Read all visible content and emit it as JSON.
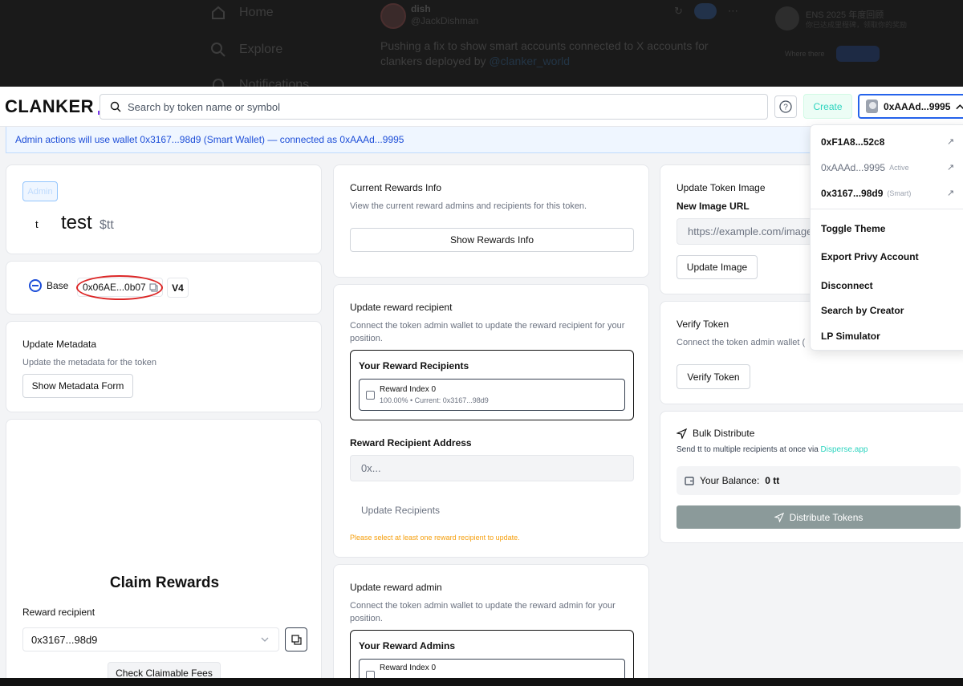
{
  "backdrop": {
    "nav": [
      "Home",
      "Explore",
      "Notifications"
    ],
    "author_name": "dish",
    "author_handle": "@JackDishman",
    "tweet_text": "Pushing a fix to show smart accounts connected to X accounts for clankers deployed by",
    "tweet_link": "@clanker_world",
    "right_title": "ENS 2025 年度回顾",
    "right_sub": "你已达成里程碑，领取你的奖励",
    "right_small": "Where there",
    "right_btn": "Follow"
  },
  "topbar": {
    "logo": "CLANKER",
    "search_placeholder": "Search by token name or symbol",
    "help_icon": "question-circle-icon",
    "create_label": "Create",
    "wallet_label": "0xAAAd...9995"
  },
  "banner": {
    "text": "Admin actions will use wallet 0x3167...98d9 (Smart Wallet) — connected as 0xAAAd...9995"
  },
  "token": {
    "admin_badge": "Admin",
    "letter": "t",
    "name": "test",
    "symbol": "$tt",
    "chain": "Base",
    "address": "0x06AE...0b07",
    "version": "V4"
  },
  "metadata": {
    "title": "Update Metadata",
    "subtitle": "Update the metadata for the token",
    "button": "Show Metadata Form"
  },
  "claim": {
    "title": "Claim Rewards",
    "recipient_label": "Reward recipient",
    "recipient_value": "0x3167...98d9",
    "check_button": "Check Claimable Fees"
  },
  "rewards_info": {
    "title": "Current Rewards Info",
    "subtitle": "View the current reward admins and recipients for this token.",
    "button": "Show Rewards Info"
  },
  "update_recipient": {
    "title": "Update reward recipient",
    "subtitle": "Connect the token admin wallet to update the reward recipient for your position.",
    "box_title": "Your Reward Recipients",
    "item_title": "Reward Index 0",
    "item_sub": "100.00% • Current: 0x3167...98d9",
    "address_label": "Reward Recipient Address",
    "address_placeholder": "0x...",
    "button": "Update Recipients",
    "warning": "Please select at least one reward recipient to update."
  },
  "update_admin": {
    "title": "Update reward admin",
    "subtitle": "Connect the token admin wallet to update the reward admin for your position.",
    "box_title": "Your Reward Admins",
    "item_title": "Reward Index 0"
  },
  "token_image": {
    "title": "Update Token Image",
    "label": "New Image URL",
    "placeholder": "https://example.com/image",
    "button": "Update Image"
  },
  "verify": {
    "title": "Verify Token",
    "subtitle": "Connect the token admin wallet (",
    "button": "Verify Token"
  },
  "bulk": {
    "title": "Bulk Distribute",
    "subtitle_pre": "Send tt to multiple recipients at once via",
    "subtitle_link": "Disperse.app",
    "balance_label": "Your Balance:",
    "balance_value": "0 tt",
    "button": "Distribute Tokens"
  },
  "dropdown": {
    "accounts": [
      {
        "address": "0xF1A8...52c8",
        "tag": ""
      },
      {
        "address": "0xAAAd...9995",
        "tag": "Active"
      },
      {
        "address": "0x3167...98d9",
        "tag": "(Smart)"
      }
    ],
    "items": [
      "Toggle Theme",
      "Export Privy Account",
      "Disconnect",
      "Search by Creator",
      "LP Simulator"
    ]
  },
  "colors": {
    "accent_teal": "#2dd4bf",
    "banner_blue": "#1d4ed8",
    "warning_orange": "#f59e0b",
    "distribute_gray": "#8b9a9a",
    "annotation_red": "#dc2626"
  }
}
